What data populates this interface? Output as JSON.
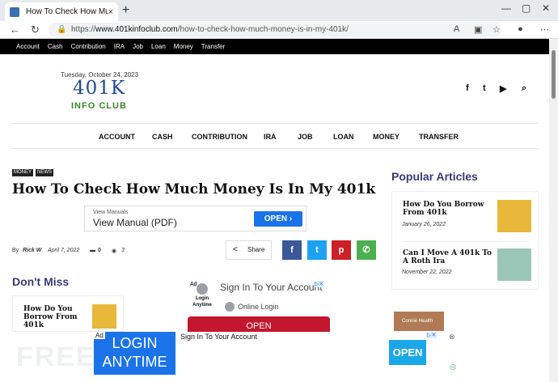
{
  "browser": {
    "tab_title": "How To Check How Much Mone",
    "tab_close": "×",
    "new_tab": "+",
    "url_prefix": "https://",
    "url_domain": "www.401kinfoclub.com",
    "url_path": "/how-to-check-how-much-money-is-in-my-401k/"
  },
  "topnav": [
    "Account",
    "Cash",
    "Contribution",
    "IRA",
    "Job",
    "Loan",
    "Money",
    "Transfer"
  ],
  "header": {
    "date": "Tuesday, October 24, 2023",
    "logo_main": "401K",
    "logo_sub": "INFO CLUB"
  },
  "mainnav": [
    "ACCOUNT",
    "CASH",
    "CONTRIBUTION",
    "IRA",
    "JOB",
    "LOAN",
    "MONEY",
    "TRANSFER"
  ],
  "article": {
    "tags": [
      "MONEY",
      "NEWS"
    ],
    "title": "How To Check How Much Money Is In My 401k",
    "by": "By",
    "author": "Rick W",
    "date": "April 7, 2022",
    "comments": "0",
    "views": "3",
    "share": "Share"
  },
  "view_manuals_ad": {
    "small": "View Manuals",
    "big": "View Manual (PDF)",
    "button": "OPEN ›"
  },
  "dont_miss": {
    "heading": "Don't Miss",
    "item_title": "How Do You Borrow From 401k"
  },
  "mid_ad": {
    "ad_label": "Ad",
    "login_small": "Login Anytime",
    "sign_in": "Sign In To Your Account",
    "online_login": "Online Login",
    "open": "OPEN"
  },
  "popular": {
    "heading": "Popular Articles",
    "items": [
      {
        "title": "How Do You Borrow From 401k",
        "date": "January 26, 2022"
      },
      {
        "title": "Can I Move A 401k To A Roth Ira",
        "date": "November 22, 2022"
      }
    ]
  },
  "side_ad": {
    "label": "Connie Health"
  },
  "bottom_ad": {
    "ad_label": "Ad",
    "login": "LOGIN ANYTIME",
    "sign_in": "Sign In To Your Account",
    "open": "OPEN",
    "watermark": "FREE"
  },
  "colors": {
    "logo_blue": "#1e4a9c",
    "logo_green": "#3d8a2a",
    "heading_purple": "#3b3a7a",
    "facebook": "#3b5998",
    "twitter": "#1da1f2",
    "pinterest": "#cb2027",
    "whatsapp": "#4caf50",
    "ad_blue": "#1a73e8",
    "ad_red": "#c2172e"
  }
}
